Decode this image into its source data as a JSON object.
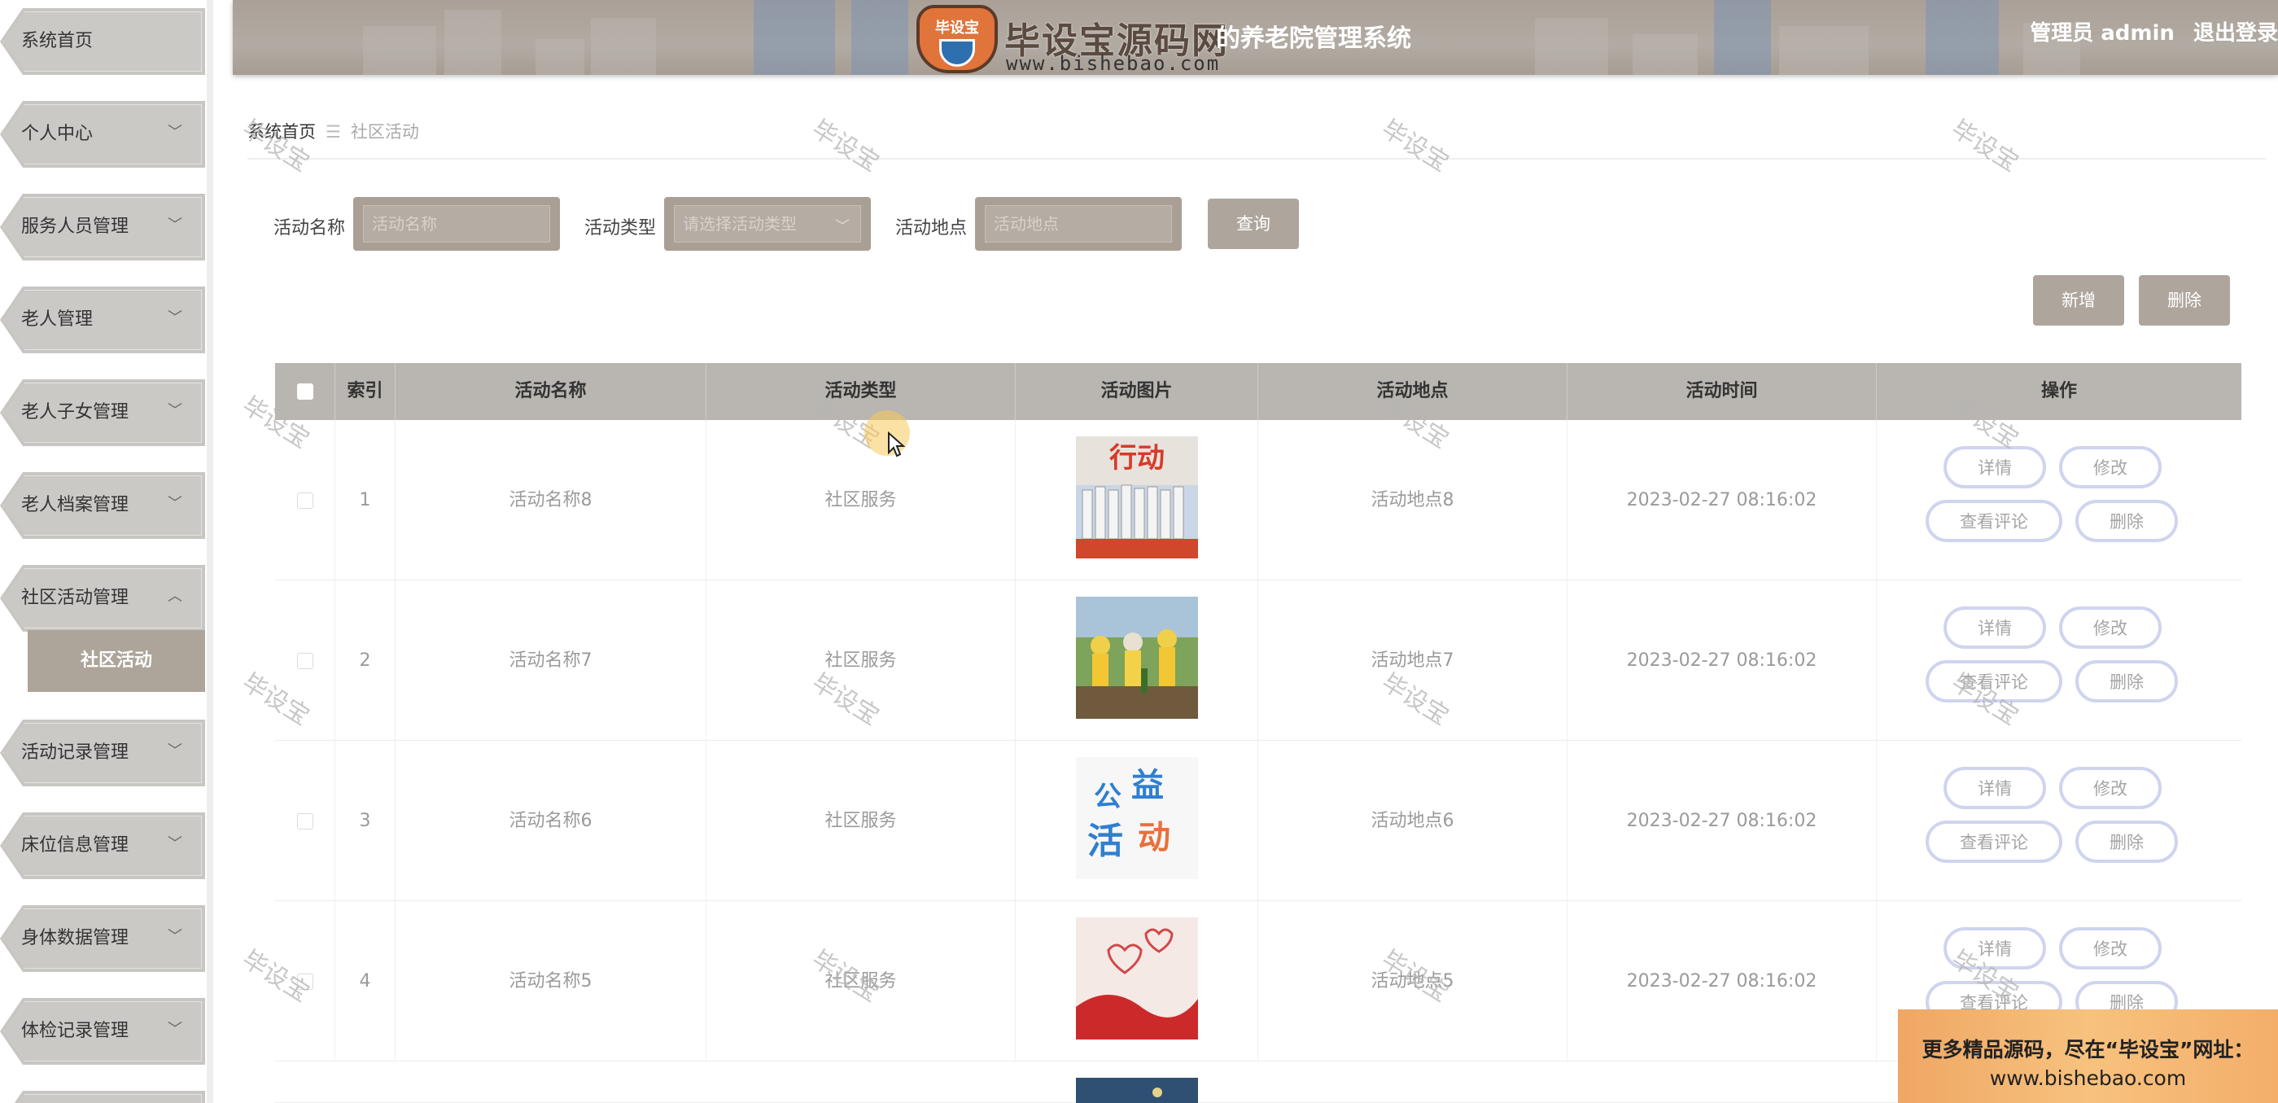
{
  "sidebar": {
    "items": [
      {
        "label": "系统首页",
        "has_chevron": false
      },
      {
        "label": "个人中心",
        "has_chevron": true
      },
      {
        "label": "服务人员管理",
        "has_chevron": true
      },
      {
        "label": "老人管理",
        "has_chevron": true
      },
      {
        "label": "老人子女管理",
        "has_chevron": true
      },
      {
        "label": "老人档案管理",
        "has_chevron": true
      },
      {
        "label": "社区活动管理",
        "has_chevron": true,
        "expanded": true
      },
      {
        "label": "活动记录管理",
        "has_chevron": true
      },
      {
        "label": "床位信息管理",
        "has_chevron": true
      },
      {
        "label": "身体数据管理",
        "has_chevron": true
      },
      {
        "label": "体检记录管理",
        "has_chevron": true
      }
    ],
    "submenu_active": "社区活动",
    "chevron_down": "﹀",
    "chevron_up": "︿"
  },
  "header": {
    "logo_badge": "毕设宝",
    "logo_title": "毕设宝源码网",
    "logo_url": "www.bishebao.com",
    "system_title": "的养老院管理系统",
    "user": "管理员 admin",
    "logout": "退出登录"
  },
  "breadcrumb": {
    "home": "系统首页",
    "separator": "☰",
    "current": "社区活动"
  },
  "search": {
    "name_label": "活动名称",
    "name_placeholder": "活动名称",
    "type_label": "活动类型",
    "type_placeholder": "请选择活动类型",
    "location_label": "活动地点",
    "location_placeholder": "活动地点",
    "query_button": "查询"
  },
  "toolbar": {
    "add_button": "新增",
    "delete_button": "删除"
  },
  "table": {
    "columns": [
      "索引",
      "活动名称",
      "活动类型",
      "活动图片",
      "活动地点",
      "活动时间",
      "操作"
    ],
    "rows": [
      {
        "index": "1",
        "name": "活动名称8",
        "type": "社区服务",
        "image": "group-photo",
        "location": "活动地点8",
        "time": "2023-02-27 08:16:02"
      },
      {
        "index": "2",
        "name": "活动名称7",
        "type": "社区服务",
        "image": "tree-planting",
        "location": "活动地点7",
        "time": "2023-02-27 08:16:02"
      },
      {
        "index": "3",
        "name": "活动名称6",
        "type": "社区服务",
        "image": "charity-logo",
        "location": "活动地点6",
        "time": "2023-02-27 08:16:02"
      },
      {
        "index": "4",
        "name": "活动名称5",
        "type": "社区服务",
        "image": "hearts",
        "location": "活动地点5",
        "time": "2023-02-27 08:16:02"
      }
    ],
    "actions": {
      "detail": "详情",
      "edit": "修改",
      "comments": "查看评论",
      "delete": "删除"
    }
  },
  "watermark": "毕设宝",
  "promo": {
    "line1": "更多精品源码，尽在“毕设宝”网址：",
    "line2": "www.bishebao.com"
  },
  "colors": {
    "accent": "#aea59c",
    "header_bg": "#aaa097",
    "action_border": "#cfd4ef",
    "promo_bg": "#f7c27e"
  }
}
